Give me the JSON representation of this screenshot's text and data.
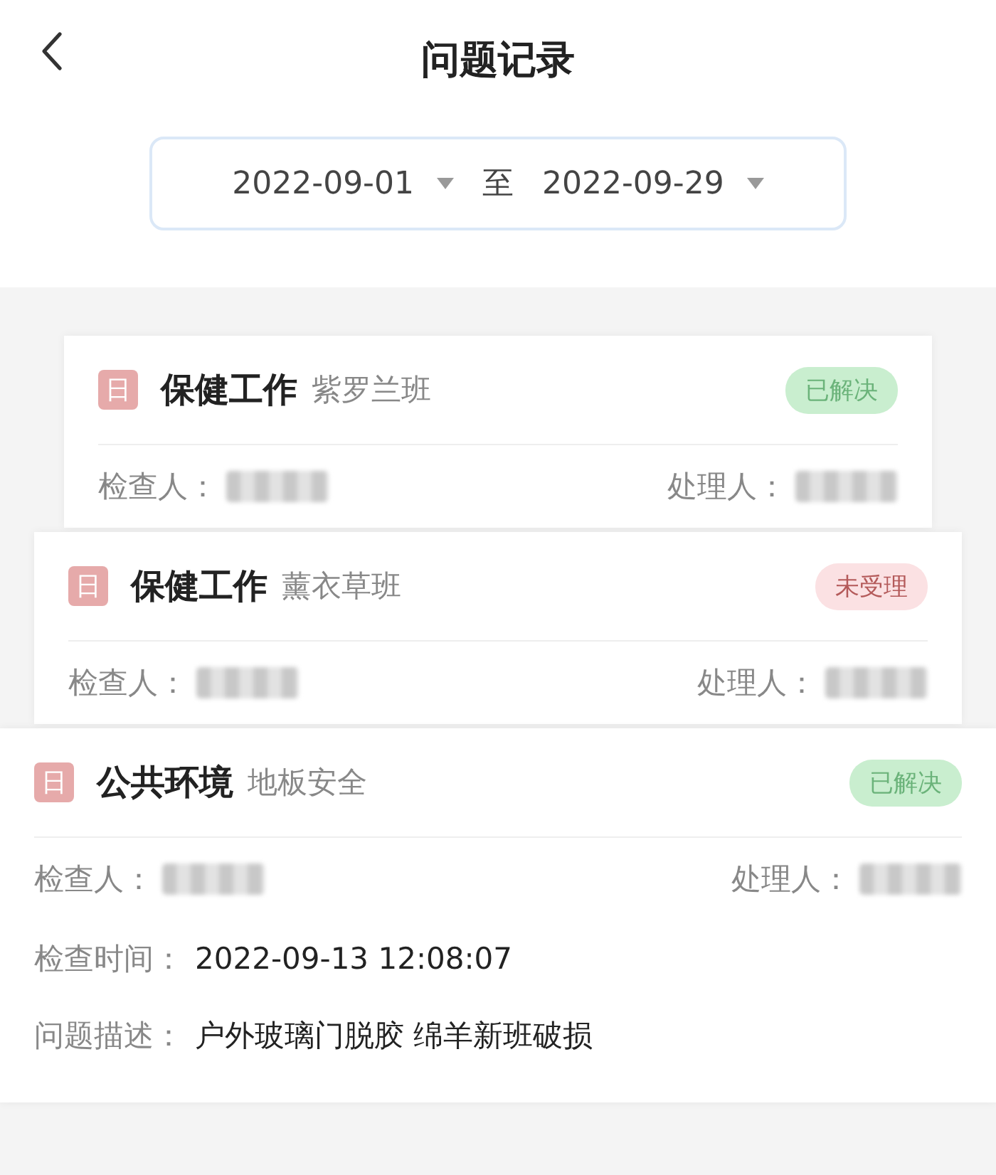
{
  "header": {
    "title": "问题记录"
  },
  "date_range": {
    "start": "2022-09-01",
    "separator": "至",
    "end": "2022-09-29"
  },
  "records": [
    {
      "badge": "日",
      "title": "保健工作",
      "subtitle": "紫罗兰班",
      "status": {
        "label": "已解决",
        "kind": "resolved"
      },
      "inspector_label": "检查人：",
      "inspector": {
        "kind": "redacted"
      },
      "handler_label": "处理人：",
      "handler": {
        "kind": "redacted"
      }
    },
    {
      "badge": "日",
      "title": "保健工作",
      "subtitle": "薰衣草班",
      "status": {
        "label": "未受理",
        "kind": "pending"
      },
      "inspector_label": "检查人：",
      "inspector": {
        "kind": "redacted"
      },
      "handler_label": "处理人：",
      "handler": {
        "kind": "redacted"
      }
    },
    {
      "badge": "日",
      "title": "公共环境",
      "subtitle": "地板安全",
      "status": {
        "label": "已解决",
        "kind": "resolved"
      },
      "inspector_label": "检查人：",
      "inspector": {
        "kind": "redacted"
      },
      "handler_label": "处理人：",
      "handler": {
        "kind": "redacted"
      },
      "details": [
        {
          "label": "检查时间：",
          "value": "2022-09-13 12:08:07"
        },
        {
          "label": "问题描述：",
          "value": "户外玻璃门脱胶 绵羊新班破损"
        }
      ]
    }
  ]
}
